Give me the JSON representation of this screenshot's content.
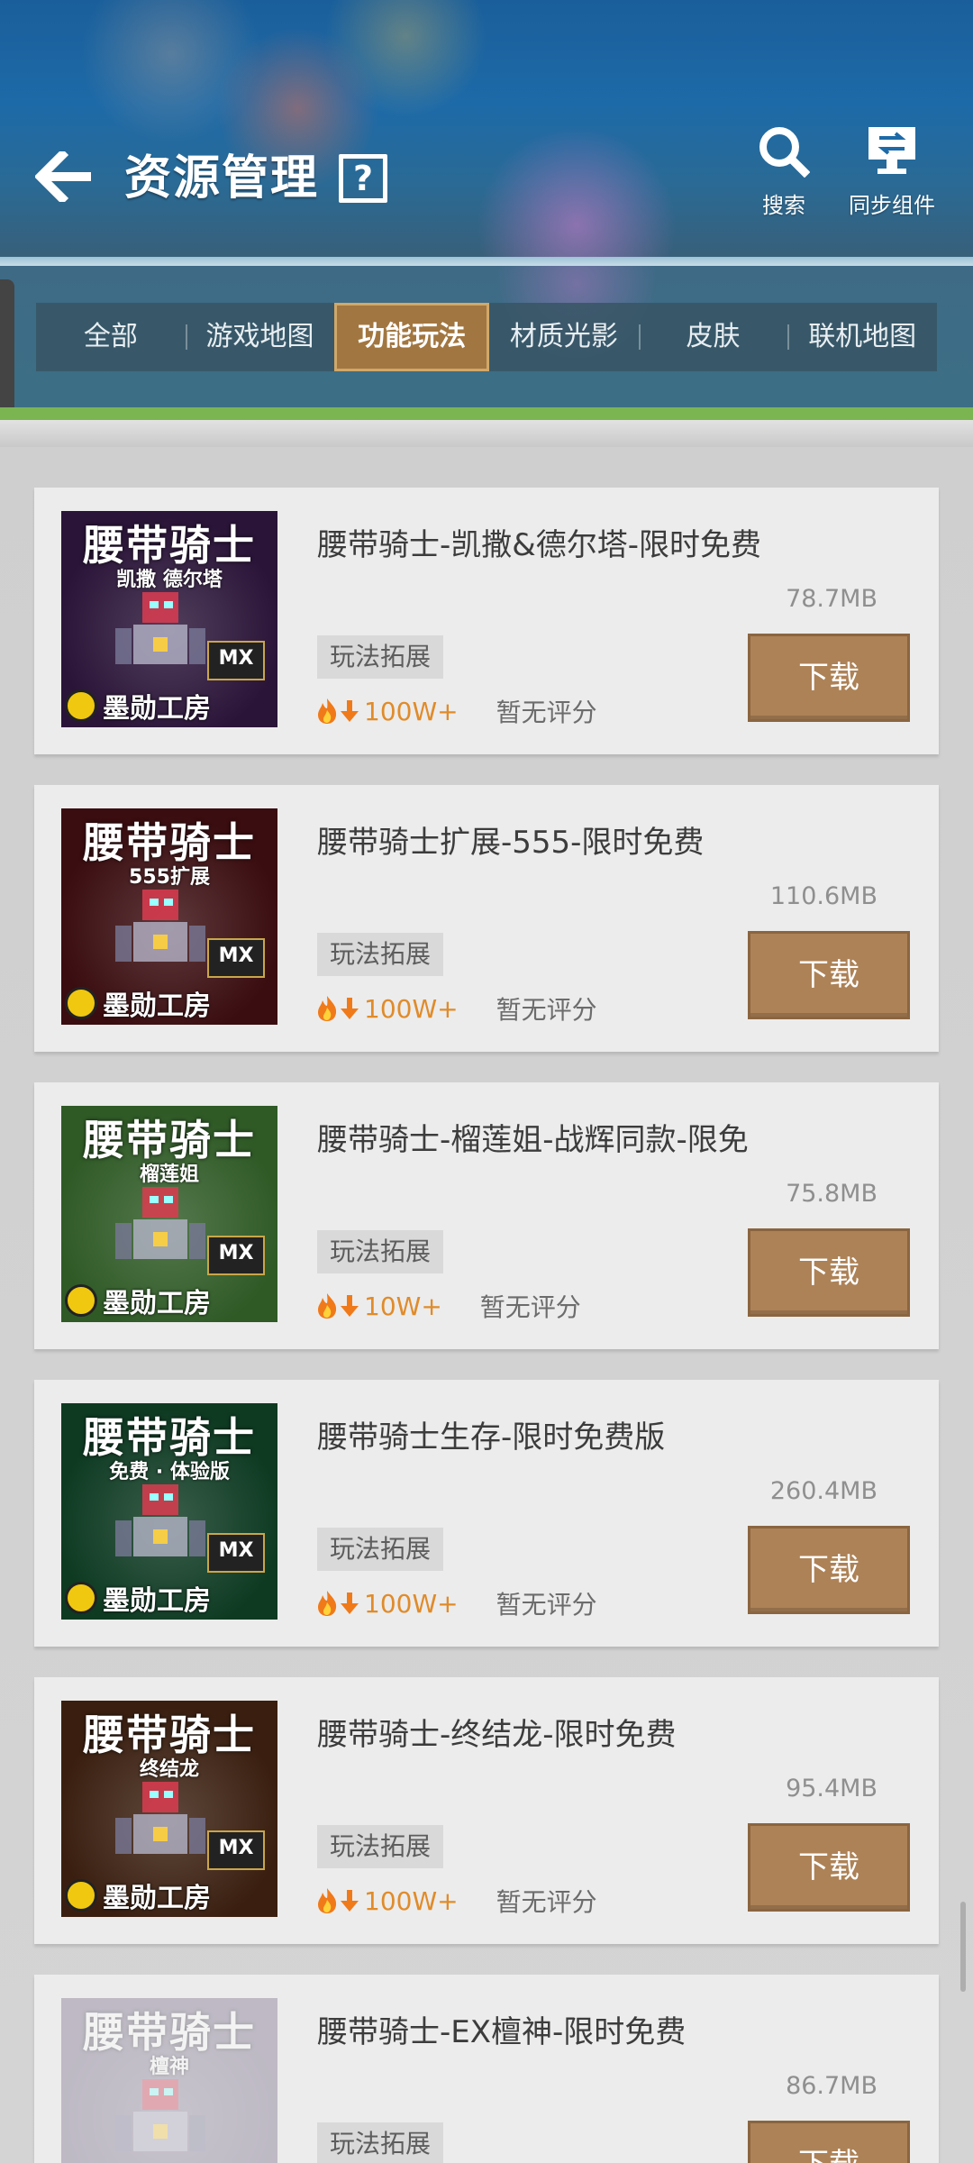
{
  "header": {
    "title": "资源管理",
    "help_label": "?",
    "search_label": "搜索",
    "sync_label": "同步组件"
  },
  "tabs": [
    {
      "label": "全部"
    },
    {
      "label": "游戏地图"
    },
    {
      "label": "功能玩法",
      "active": true
    },
    {
      "label": "材质光影"
    },
    {
      "label": "皮肤"
    },
    {
      "label": "联机地图"
    }
  ],
  "download_label": "下载",
  "items": [
    {
      "title": "腰带骑士-凯撒&德尔塔-限时免费",
      "size": "78.7MB",
      "tag": "玩法拓展",
      "downloads": "100W+",
      "rating": "暂无评分",
      "thumb_title": "腰带骑士",
      "thumb_subtitle": "凯撒 德尔塔",
      "thumb_brand": "墨勋工房",
      "thumb_badge": "MX",
      "thumb_color": "#2a1438"
    },
    {
      "title": "腰带骑士扩展-555-限时免费",
      "size": "110.6MB",
      "tag": "玩法拓展",
      "downloads": "100W+",
      "rating": "暂无评分",
      "thumb_title": "腰带骑士",
      "thumb_subtitle": "555扩展",
      "thumb_brand": "墨勋工房",
      "thumb_badge": "MX",
      "thumb_color": "#3a0d10"
    },
    {
      "title": "腰带骑士-榴莲姐-战辉同款-限免",
      "size": "75.8MB",
      "tag": "玩法拓展",
      "downloads": "10W+",
      "rating": "暂无评分",
      "thumb_title": "腰带骑士",
      "thumb_subtitle": "榴莲姐",
      "thumb_brand": "墨勋工房",
      "thumb_badge": "MX",
      "thumb_color": "#2f5a26"
    },
    {
      "title": "腰带骑士生存-限时免费版",
      "size": "260.4MB",
      "tag": "玩法拓展",
      "downloads": "100W+",
      "rating": "暂无评分",
      "thumb_title": "腰带骑士",
      "thumb_subtitle": "免费 · 体验版",
      "thumb_brand": "墨勋工房",
      "thumb_badge": "MX",
      "thumb_color": "#0e3a22"
    },
    {
      "title": "腰带骑士-终结龙-限时免费",
      "size": "95.4MB",
      "tag": "玩法拓展",
      "downloads": "100W+",
      "rating": "暂无评分",
      "thumb_title": "腰带骑士",
      "thumb_subtitle": "终结龙",
      "thumb_brand": "墨勋工房",
      "thumb_badge": "MX",
      "thumb_color": "#3a1f10"
    },
    {
      "title": "腰带骑士-EX檀神-限时免费",
      "size": "86.7MB",
      "tag": "玩法拓展",
      "downloads": "",
      "rating": "",
      "thumb_title": "腰带骑士",
      "thumb_subtitle": "檀神",
      "thumb_brand": "",
      "thumb_badge": "",
      "thumb_color": "#7a6f8a"
    }
  ],
  "colors": {
    "accent_tab": "#a27640",
    "download_button": "#ad8257",
    "download_count": "#e08b2a",
    "green_strip": "#7ab552"
  }
}
